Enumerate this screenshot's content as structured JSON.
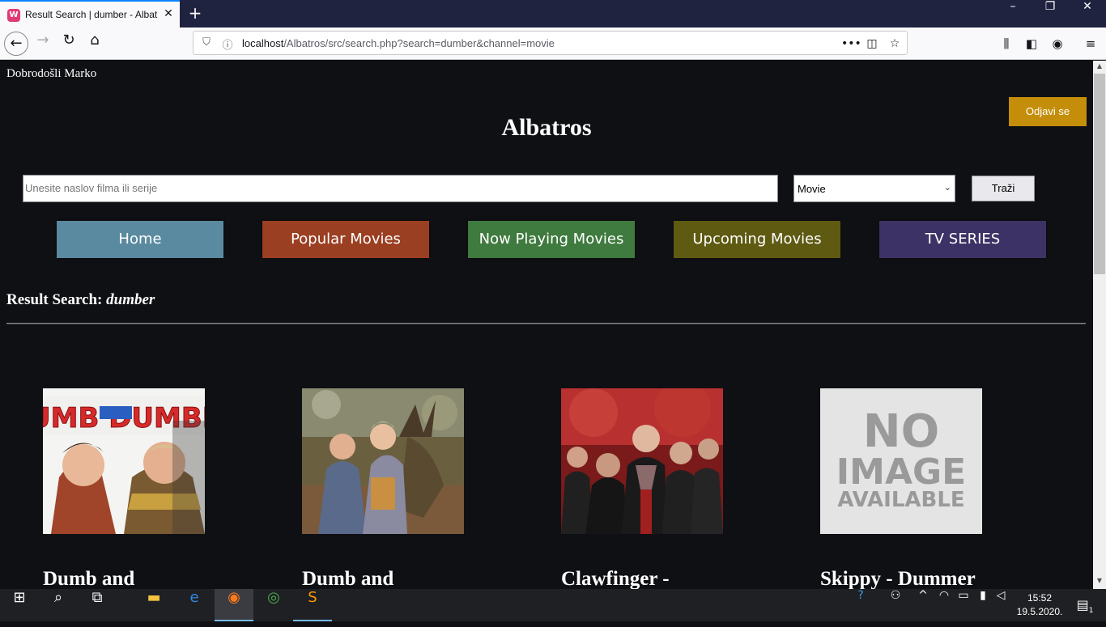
{
  "browser": {
    "tab_title": "Result Search | dumber - Albatros",
    "tab_favicon_letter": "W",
    "new_tab_symbol": "+",
    "url_host": "localhost",
    "url_path": "/Albatros/src/search.php?search=dumber&channel=movie",
    "url_more": "•••"
  },
  "page": {
    "welcome": "Dobrodošli Marko",
    "logout_label": "Odjavi se",
    "site_title": "Albatros",
    "search": {
      "placeholder": "Unesite naslov filma ili serije",
      "channel_value": "Movie",
      "button_label": "Traži"
    },
    "menu": [
      {
        "label": "Home",
        "color": "#5a8aa0"
      },
      {
        "label": "Popular Movies",
        "color": "#9b3f22"
      },
      {
        "label": "Now Playing Movies",
        "color": "#3f7a3f"
      },
      {
        "label": "Upcoming Movies",
        "color": "#5f5a12"
      },
      {
        "label": "TV SERIES",
        "color": "#3d3266"
      }
    ],
    "result_label": "Result Search:",
    "result_query": "dumber",
    "results": [
      {
        "title": "Dumb and",
        "poster": "dumb-and-dumber-poster"
      },
      {
        "title": "Dumb and",
        "poster": "dumb-and-dumber-to-poster"
      },
      {
        "title": "Clawfinger -",
        "poster": "clawfinger-band-photo"
      },
      {
        "title": "Skippy - Dummer",
        "poster": "no-image-available",
        "poster_text": [
          "NO",
          "IMAGE",
          "AVAILABLE"
        ]
      }
    ]
  },
  "taskbar": {
    "time": "15:52",
    "date": "19.5.2020.",
    "notification_count": "1"
  }
}
